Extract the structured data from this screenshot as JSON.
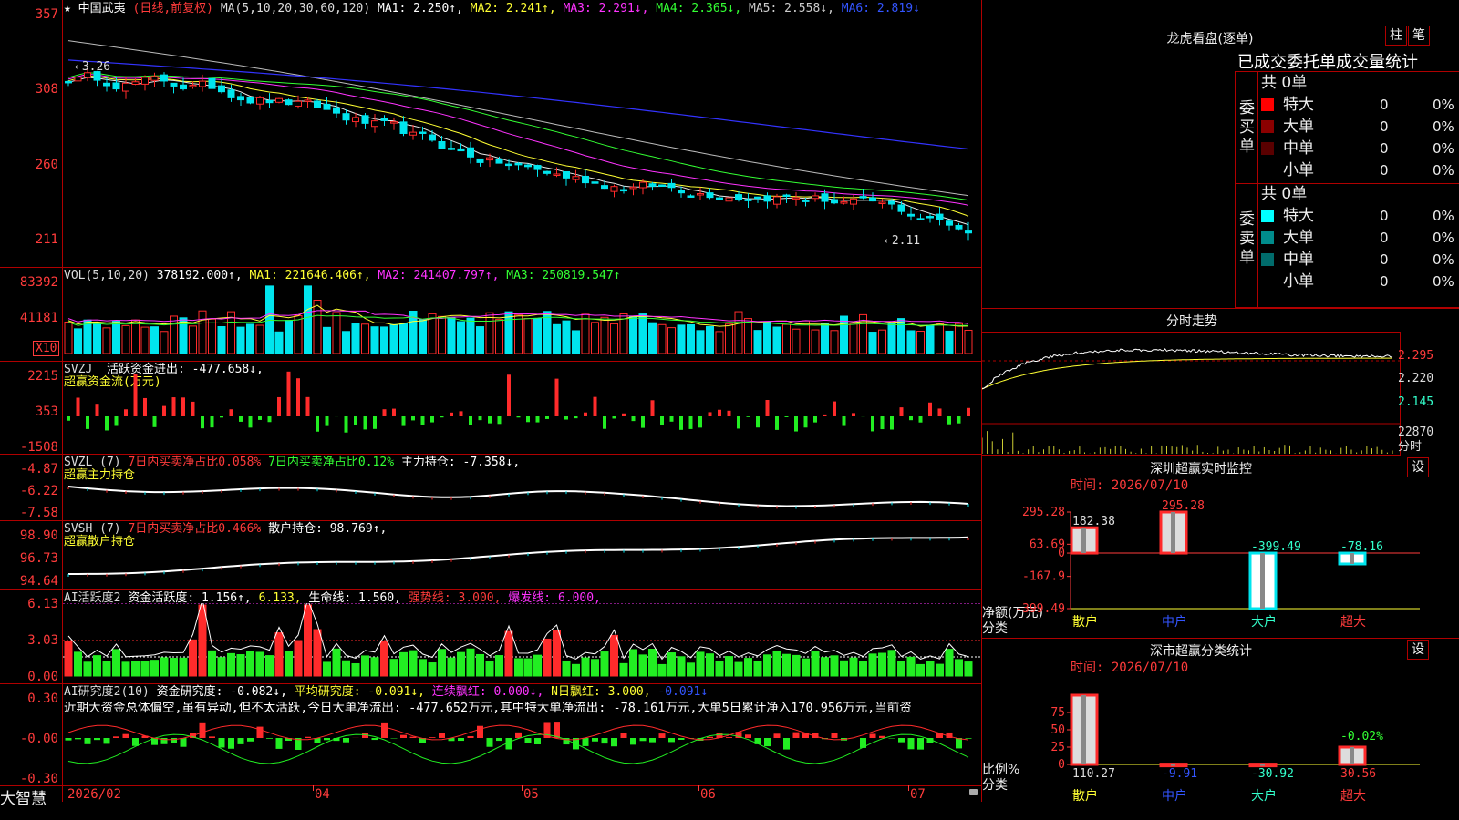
{
  "colors": {
    "up": "#ff2b2b",
    "down": "#00e5ee",
    "ma1": "#e8e8e8",
    "ma2": "#ffff33",
    "ma3": "#ff33ff",
    "ma4": "#33ff33",
    "ma5": "#bbbbbb",
    "ma6": "#3333ff",
    "green": "#22ee22",
    "red": "#ff2b2b"
  },
  "kline": {
    "star": "★",
    "name": "中国武夷",
    "period": "(日线,前复权)",
    "ma_label": "MA(5,10,20,30,60,120)",
    "ma1": "MA1: 2.250↑,",
    "ma2": "MA2: 2.241↑,",
    "ma3": "MA3: 2.291↓,",
    "ma4": "MA4: 2.365↓,",
    "ma5": "MA5: 2.558↓,",
    "ma6": "MA6: 2.819↓",
    "y_ticks": [
      "357",
      "308",
      "260",
      "211"
    ],
    "high_mark": "3.26",
    "low_mark": "2.11"
  },
  "vol": {
    "label": "VOL(5,10,20)",
    "value": "378192.000↑,",
    "ma1": "MA1: 221646.406↑,",
    "ma2": "MA2: 241407.797↑,",
    "ma3": "MA3: 250819.547↑",
    "y_ticks": [
      "83392",
      "41181"
    ],
    "unit": "X10"
  },
  "svzj": {
    "label": "SVZJ",
    "desc": "活跃资金进出: -477.658↓,",
    "sub": "超赢资金流(万元)",
    "y_ticks": [
      "2215",
      "353",
      "-1508"
    ]
  },
  "svzl": {
    "label": "SVZL (7)",
    "a": "7日内买卖净占比0.058%",
    "b": "7日内买卖净占比0.12%",
    "c": "主力持仓: -7.358↓,",
    "sub": "超赢主力持仓",
    "y_ticks": [
      "-4.87",
      "-6.22",
      "-7.58"
    ]
  },
  "svsh": {
    "label": "SVSH (7)",
    "a": "7日内买卖净占比0.466%",
    "c": "散户持仓: 98.769↑,",
    "sub": "超赢散户持仓",
    "y_ticks": [
      "98.90",
      "96.73",
      "94.64"
    ]
  },
  "ai1": {
    "label": "AI活跃度2",
    "a": "资金活跃度: 1.156↑,",
    "b": "6.133,",
    "c": "生命线: 1.560,",
    "d": "强势线: 3.000,",
    "e": "爆发线: 6.000,",
    "y_ticks": [
      "6.13",
      "3.03",
      "0.00"
    ]
  },
  "ai2": {
    "label": "AI研究度2(10)",
    "a": "资金研究度: -0.082↓,",
    "b": "平均研究度: -0.091↓,",
    "c": "连续飘红: 0.000↓,",
    "d": "N日飘红: 3.000,",
    "e": "-0.091↓",
    "comment": "近期大资金总体偏空,虽有异动,但不太活跃,今日大单净流出: -477.652万元,其中特大单净流出: -78.161万元,大单5日累计净入170.956万元,当前资",
    "y_ticks": [
      "0.30",
      "-0.00",
      "-0.30"
    ]
  },
  "footer": {
    "brand": "大智慧",
    "dates": [
      "2026/02",
      "04",
      "05",
      "06",
      "07"
    ]
  },
  "right": {
    "title": "龙虎看盘(逐单)",
    "btn1": "柱",
    "btn2": "笔",
    "heading": "已成交委托单成交量统计",
    "buy": {
      "side": "委买单",
      "total": "共 0单",
      "rows": [
        {
          "name": "特大",
          "val": "0",
          "pct": "0%",
          "color": "#ff0000"
        },
        {
          "name": "大单",
          "val": "0",
          "pct": "0%",
          "color": "#8b0000"
        },
        {
          "name": "中单",
          "val": "0",
          "pct": "0%",
          "color": "#5a0000"
        },
        {
          "name": "小单",
          "val": "0",
          "pct": "0%",
          "color": "#000000"
        }
      ]
    },
    "sell": {
      "side": "委卖单",
      "total": "共 0单",
      "rows": [
        {
          "name": "特大",
          "val": "0",
          "pct": "0%",
          "color": "#00ffff"
        },
        {
          "name": "大单",
          "val": "0",
          "pct": "0%",
          "color": "#008b8b"
        },
        {
          "name": "中单",
          "val": "0",
          "pct": "0%",
          "color": "#006b6b"
        },
        {
          "name": "小单",
          "val": "0",
          "pct": "0%",
          "color": "#000000"
        }
      ]
    },
    "intraday": {
      "title": "分时走势",
      "prices": [
        "2.295",
        "2.220",
        "2.145"
      ],
      "vol": "22870",
      "vol_label": "分时"
    },
    "sz": {
      "title": "深圳超赢实时监控",
      "btn": "设",
      "time": "时间: 2026/07/10",
      "y_ticks": [
        "295.28",
        "63.69",
        "0",
        "-167.9",
        "-399.49"
      ],
      "ylabel": "净额(万元)",
      "xlabel": "分类",
      "cats": [
        "散户",
        "中户",
        "大户",
        "超大"
      ],
      "vals": [
        "182.38",
        "295.28",
        "-399.49",
        "-78.16"
      ]
    },
    "sc": {
      "title": "深市超赢分类统计",
      "btn": "设",
      "time": "时间: 2026/07/10",
      "y_ticks": [
        "75",
        "50",
        "25",
        "0"
      ],
      "ylabel": "比例%",
      "xlabel": "分类",
      "cats": [
        "散户",
        "中户",
        "大户",
        "超大"
      ],
      "vals": [
        "110.27",
        "-9.91",
        "-30.92",
        "30.56"
      ],
      "note": "-0.02%"
    }
  },
  "chart_data": [
    {
      "type": "candlestick",
      "title": "中国武夷 (日线,前复权)",
      "ylim": [
        2.05,
        3.6
      ],
      "high": 3.26,
      "low": 2.11,
      "x_ticks": [
        "2026/02",
        "04",
        "05",
        "06",
        "07"
      ]
    },
    {
      "type": "bar",
      "title": "SVZJ 活跃资金进出",
      "ylim": [
        -1508,
        2215
      ],
      "last": -477.658
    },
    {
      "type": "bar",
      "title": "深圳超赢实时监控",
      "categories": [
        "散户",
        "中户",
        "大户",
        "超大"
      ],
      "values": [
        182.38,
        295.28,
        -399.49,
        -78.16
      ],
      "ylim": [
        -399.49,
        295.28
      ]
    },
    {
      "type": "bar",
      "title": "深市超赢分类统计",
      "categories": [
        "散户",
        "中户",
        "大户",
        "超大"
      ],
      "values": [
        110.27,
        -9.91,
        -30.92,
        30.56
      ],
      "ylim": [
        0,
        75
      ]
    }
  ]
}
